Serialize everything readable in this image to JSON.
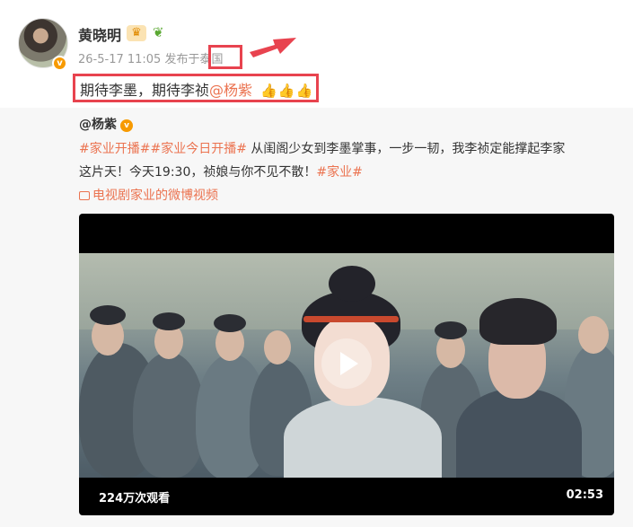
{
  "author": {
    "name": "黄晓明",
    "avatar_badge": "v",
    "icons": [
      "crown-icon",
      "sprout-icon"
    ]
  },
  "post_meta": {
    "time": "26-5-17 11:05",
    "from_label": "发布于",
    "location": "泰国"
  },
  "post": {
    "text": "期待李墨，期待李祯",
    "mention": "@杨紫",
    "emoji": "👍👍👍"
  },
  "repost": {
    "author": "@杨紫",
    "badge": "v",
    "line1_tags": "#家业开播##家业今日开播#",
    "line1_text": " 从闺阁少女到李墨掌事，一步一韧，我李祯定能撑起李家",
    "line2_text": "这片天！今天19:30，祯娘与你不见不散！",
    "line2_tag": "#家业#",
    "video_link": "电视剧家业的微博视频"
  },
  "video": {
    "views": "224万次观看",
    "duration": "02:53"
  },
  "colors": {
    "accent": "#eb7350",
    "highlight_box": "#e8434f",
    "verified": "#f79a00"
  }
}
